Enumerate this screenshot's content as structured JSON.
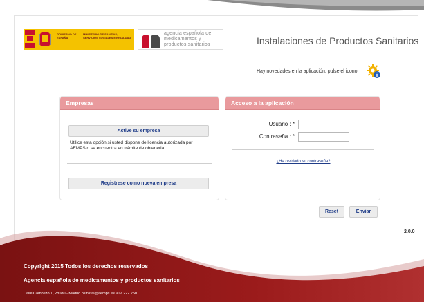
{
  "header": {
    "gobierno_text": "GOBIERNO DE ESPAÑA",
    "ministerio_text": "MINISTERIO DE SANIDAD, SERVICIOS SOCIALES E IGUALDAD",
    "agency_logo_text": "agencia española de medicamentos y productos sanitarios",
    "app_title": "Instalaciones de Productos Sanitarios",
    "notice": "Hay novedades en la aplicación, pulse el icono"
  },
  "empresas": {
    "title": "Empresas",
    "activate_label": "Active su empresa",
    "help_text": "Utilice esta opción si usted dispone de licencia autorizada por AEMPS o se encuentra en trámite de obtenerla.",
    "register_label": "Registrese como nueva empresa"
  },
  "acceso": {
    "title": "Acceso a la aplicación",
    "user_label": "Usuario : *",
    "user_value": "",
    "pass_label": "Contraseña : *",
    "pass_value": "",
    "forgot_link": "¿Ha olvidado su contraseña?"
  },
  "actions": {
    "reset_label": "Reset",
    "send_label": "Enviar"
  },
  "version": "2.0.0",
  "footer": {
    "copyright": "Copyright 2015 Todos los derechos reservados",
    "agency": "Agencia española de medicamentos y productos sanitarios",
    "address": "Calle Campezo 1, 28080 - Madrid  psinstal@aemps.es   902 222 250"
  },
  "colors": {
    "panel_header": "#e99a9d",
    "footer_red": "#8e1a1a",
    "gob_yellow": "#f4c200",
    "link_blue": "#1f3c88"
  },
  "icons": {
    "notice": "gear-info-icon",
    "escudo": "coat-of-arms-icon",
    "aemps": "aemps-logo-mark"
  }
}
